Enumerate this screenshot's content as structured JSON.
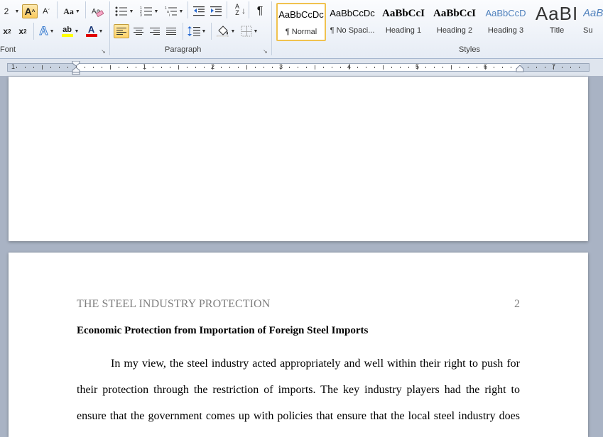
{
  "ribbon": {
    "font_size_value": "2",
    "grow_font_label": "A",
    "shrink_font_label": "A",
    "change_case_label": "Aa",
    "subscript_label": "x",
    "superscript_label": "x",
    "text_effects_label": "A",
    "highlight_label": "ab",
    "font_color_label": "A",
    "pilcrow_label": "¶",
    "sort_label_top": "A",
    "sort_label_bottom": "Z",
    "groups": {
      "font": "Font",
      "paragraph": "Paragraph",
      "styles": "Styles"
    },
    "styles": [
      {
        "preview": "AaBbCcDc",
        "name": "¶ Normal"
      },
      {
        "preview": "AaBbCcDc",
        "name": "¶ No Spaci..."
      },
      {
        "preview": "AaBbCcI",
        "name": "Heading 1"
      },
      {
        "preview": "AaBbCcI",
        "name": "Heading 2"
      },
      {
        "preview": "AaBbCcD",
        "name": "Heading 3"
      },
      {
        "preview": "AaBI",
        "name": "Title"
      },
      {
        "preview": "AaB",
        "name": "Su"
      }
    ],
    "colors": {
      "highlight": "#ffff00",
      "font_color": "#e00000",
      "heading3": "#4f81bd",
      "selected_border": "#f0c24f"
    }
  },
  "ruler": {
    "numbers": [
      "1",
      "1",
      "2",
      "3",
      "4",
      "5",
      "6",
      "7"
    ]
  },
  "document": {
    "header": "THE STEEL INDUSTRY PROTECTION",
    "page_number": "2",
    "heading": "Economic Protection from Importation of Foreign Steel Imports",
    "body_lines": [
      "In my view, the steel industry acted appropriately and well within their right to push for",
      "their protection through the restriction of imports. The key industry players had the right to",
      "ensure that the government comes up with policies that ensure that the local steel industry does"
    ]
  }
}
